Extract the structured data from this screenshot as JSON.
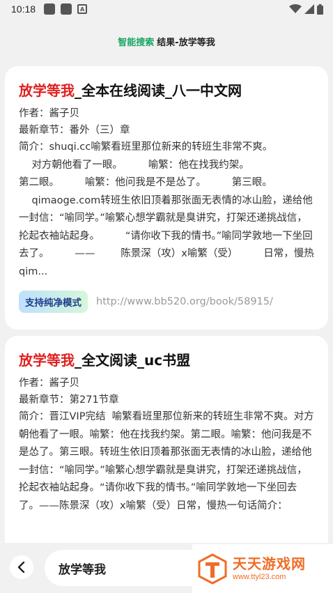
{
  "status_bar": {
    "time": "10:18",
    "a_icon_text": "A"
  },
  "header": {
    "accent": "智能搜索",
    "rest": "结果-放学等我"
  },
  "results": [
    {
      "title_highlight": "放学等我",
      "title_rest": "_全本在线阅读_八一中文网",
      "author": "作者：酱子贝",
      "latest": "最新章节：番外（三）章",
      "summary": "简介：shuqi.cc喻繁看班里那位新来的转班生非常不爽。\n    对方朝他看了一眼。        喻繁：他在找我约架。\n第二眼。        喻繁：他问我是不是怂了。        第三眼。\n    qimaoge.com转班生依旧顶着那张面无表情的冰山脸，递给他一封信：“喻同学。”喻繁心想学霸就是臭讲究，打架还递挑战信，抡起衣袖站起身。        “请你收下我的情书。”喻同学敦地一下坐回去了。        ——        陈景深（攻）x喻繁（受）        日常，慢热qim...",
      "badge": "支持纯净模式",
      "url": "http://www.bb520.org/book/58915/"
    },
    {
      "title_highlight": "放学等我",
      "title_rest": "_全文阅读_uc书盟",
      "author": "作者：酱子贝",
      "latest": "最新章节：第271节章",
      "summary": "简介：晋江VIP完结  喻繁看班里那位新来的转班生非常不爽。对方朝他看了一眼。喻繁：他在找我约架。第二眼。喻繁：他问我是不是怂了。第三眼。转班生依旧顶着那张面无表情的冰山脸，递给他一封信：“喻同学。”喻繁心想学霸就是臭讲究，打架还递挑战信，抡起衣袖站起身。“请你收下我的情书。”喻同学敦地一下坐回去了。——陈景深（攻）x喻繁（受）日常，慢热一句话简介："
    }
  ],
  "bottom": {
    "search_text": "放学等我"
  },
  "watermark": {
    "main": "天天游戏网",
    "sub": "www.ttyl23.com"
  },
  "colors": {
    "accent_green": "#1aa564",
    "highlight_red": "#e02020",
    "watermark_orange": "#ef6d27"
  }
}
